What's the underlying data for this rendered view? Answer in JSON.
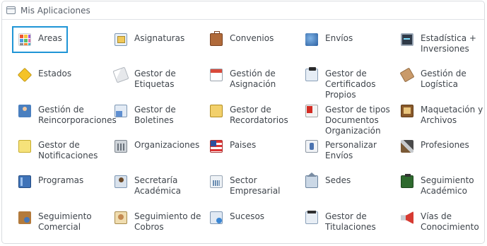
{
  "panel": {
    "title": "Mis Aplicaciones"
  },
  "apps": [
    [
      "Areas"
    ],
    [
      "Asignaturas"
    ],
    [
      "Convenios"
    ],
    [
      "Envíos"
    ],
    [
      "Estadística +",
      "Inversiones"
    ],
    [
      "Estados"
    ],
    [
      "Gestor de",
      "Etiquetas"
    ],
    [
      "Gestión de",
      "Asignación"
    ],
    [
      "Gestor de",
      "Certificados",
      "Propios"
    ],
    [
      "Gestión de",
      "Logística"
    ],
    [
      "Gestión de",
      "Reincorporaciones"
    ],
    [
      "Gestor de",
      "Boletines"
    ],
    [
      "Gestor de",
      "Recordatorios"
    ],
    [
      "Gestor de tipos",
      "Documentos",
      "Organización"
    ],
    [
      "Maquetación y",
      "Archivos"
    ],
    [
      "Gestor de",
      "Notificaciones"
    ],
    [
      "Organizaciones"
    ],
    [
      "Paises"
    ],
    [
      "Personalizar",
      "Envíos"
    ],
    [
      "Profesiones"
    ],
    [
      "Programas"
    ],
    [
      "Secretaría",
      "Académica"
    ],
    [
      "Sector",
      "Empresarial"
    ],
    [
      "Sedes"
    ],
    [
      "Seguimiento",
      "Académico"
    ],
    [
      "Seguimiento",
      "Comercial"
    ],
    [
      "Seguimiento de",
      "Cobros"
    ],
    [
      "Sucesos"
    ],
    [
      "Gestor de",
      "Titulaciones"
    ],
    [
      "Vías de",
      "Conocimiento"
    ]
  ],
  "icons": [
    "areas-icon",
    "asignaturas-icon",
    "convenios-icon",
    "envios-icon",
    "estadistica-icon",
    "estados-icon",
    "etiquetas-icon",
    "asignacion-icon",
    "certificados-icon",
    "logistica-icon",
    "reincorporaciones-icon",
    "boletines-icon",
    "recordatorios-icon",
    "tipos-documentos-icon",
    "maquetacion-icon",
    "notificaciones-icon",
    "organizaciones-icon",
    "paises-icon",
    "personalizar-envios-icon",
    "profesiones-icon",
    "programas-icon",
    "secretaria-icon",
    "sector-empresarial-icon",
    "sedes-icon",
    "seguimiento-academico-icon",
    "seguimiento-comercial-icon",
    "seguimiento-cobros-icon",
    "sucesos-icon",
    "titulaciones-icon",
    "vias-conocimiento-icon"
  ],
  "selected_index": 0
}
